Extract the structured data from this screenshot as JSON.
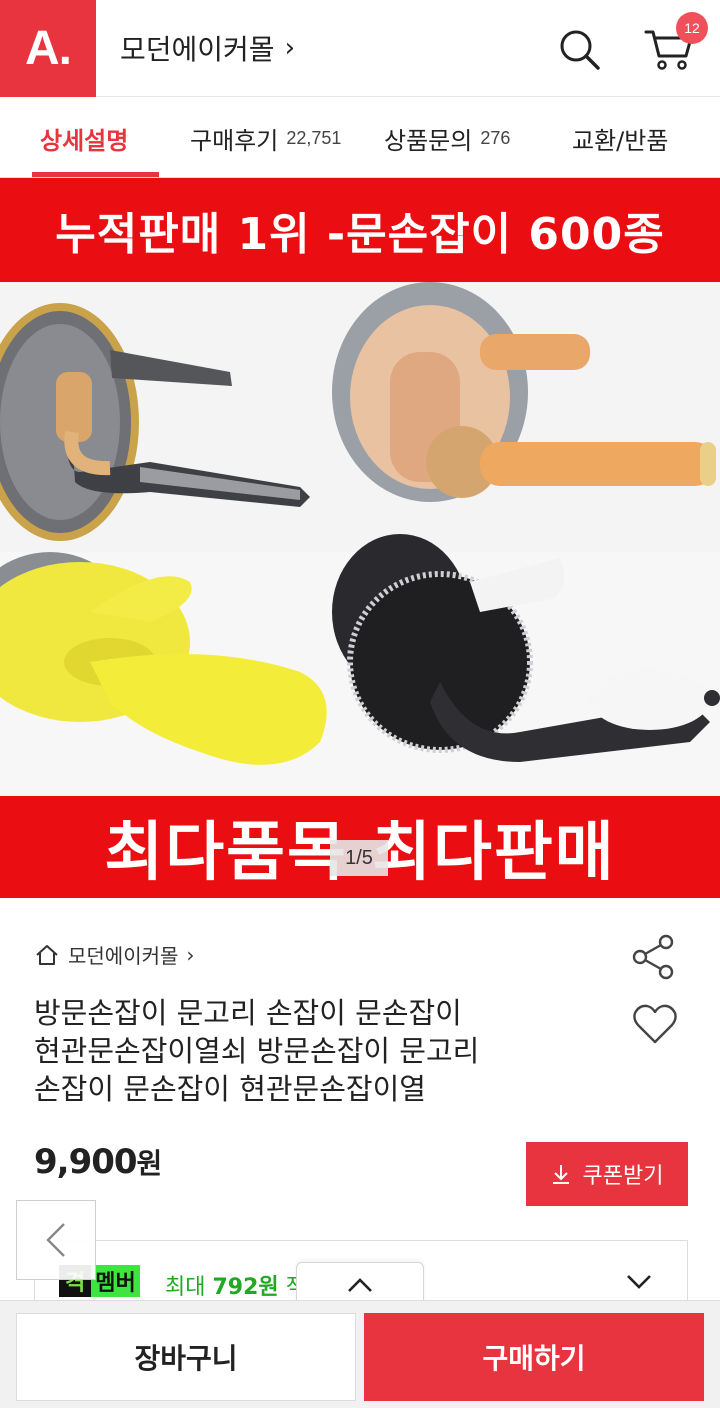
{
  "header": {
    "logo_text": "A.",
    "store_name": "모던에이커몰",
    "store_chevron": "›",
    "cart_count": "12",
    "brand_color": "#e8343e"
  },
  "tabs": [
    {
      "label": "상세설명",
      "count": "",
      "active": true
    },
    {
      "label": "구매후기",
      "count": "22,751",
      "active": false
    },
    {
      "label": "상품문의",
      "count": "276",
      "active": false
    },
    {
      "label": "교환/반품",
      "count": "",
      "active": false
    }
  ],
  "hero": {
    "banner_top": "누적판매 1위 -문손잡이 600종",
    "banner_bottom": "최다품목 최다판매",
    "slide_indicator": "1/5",
    "banner_color": "#ea0e12"
  },
  "product": {
    "breadcrumb_store": "모던에이커몰",
    "breadcrumb_chevron": "›",
    "title_lines": [
      "방문손잡이 문고리 손잡이 문손잡이",
      "현관문손잡이열쇠 방문손잡이 문고리",
      "손잡이 문손잡이 현관문손잡이열"
    ],
    "price_value": "9,900",
    "price_unit": "원",
    "coupon_label": "쿠폰받기"
  },
  "membership": {
    "badge_left": "격",
    "badge_right": "멤버",
    "text_prefix": "최대 ",
    "amount": "792원",
    "text_suffix": " 적"
  },
  "bottom_bar": {
    "cart_label": "장바구니",
    "buy_label": "구매하기"
  }
}
